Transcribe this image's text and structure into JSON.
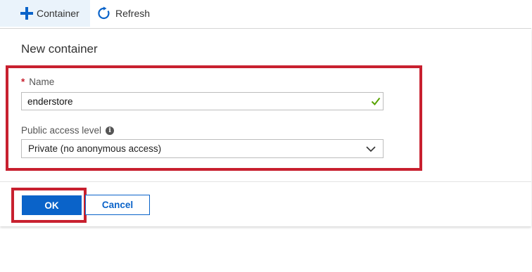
{
  "toolbar": {
    "container_label": "Container",
    "container_icon": "plus-icon",
    "refresh_label": "Refresh",
    "refresh_icon": "refresh-icon"
  },
  "panel": {
    "title": "New container",
    "name_field": {
      "required_marker": "*",
      "label": "Name",
      "value": "enderstore",
      "valid_icon": "check-icon"
    },
    "access_field": {
      "label": "Public access level",
      "info_icon": "info-icon",
      "selected": "Private (no anonymous access)",
      "dropdown_icon": "chevron-down-icon"
    },
    "ok_label": "OK",
    "cancel_label": "Cancel"
  },
  "colors": {
    "accent": "#0a63c9",
    "highlight": "#c8202f",
    "valid": "#57a300",
    "toolbar_active_bg": "#eaf3fb"
  }
}
